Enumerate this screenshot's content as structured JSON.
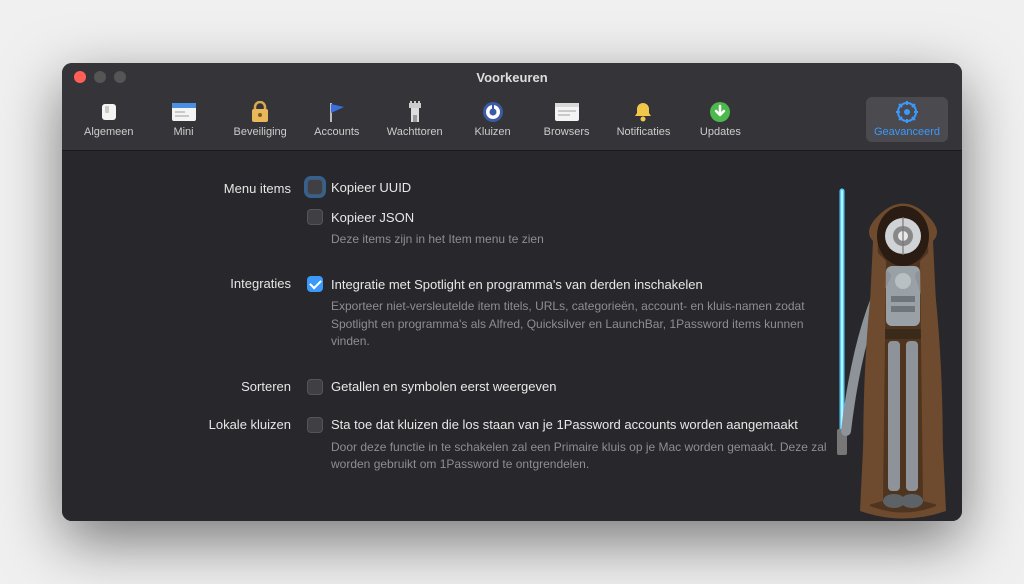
{
  "window": {
    "title": "Voorkeuren"
  },
  "toolbar": {
    "tabs": [
      {
        "label": "Algemeen"
      },
      {
        "label": "Mini"
      },
      {
        "label": "Beveiliging"
      },
      {
        "label": "Accounts"
      },
      {
        "label": "Wachttoren"
      },
      {
        "label": "Kluizen"
      },
      {
        "label": "Browsers"
      },
      {
        "label": "Notificaties"
      },
      {
        "label": "Updates"
      }
    ],
    "advanced": {
      "label": "Geavanceerd"
    }
  },
  "sections": {
    "menu_items": {
      "label": "Menu items",
      "copy_uuid": "Kopieer UUID",
      "copy_json": "Kopieer JSON",
      "help": "Deze items zijn in het Item menu te zien"
    },
    "integrations": {
      "label": "Integraties",
      "enable": "Integratie met Spotlight en programma's van derden inschakelen",
      "help": "Exporteer niet-versleutelde item titels, URLs, categorieën, account- en kluis-namen zodat Spotlight en programma's als Alfred, Quicksilver en LaunchBar, 1Password items kunnen vinden."
    },
    "sorting": {
      "label": "Sorteren",
      "numbers_first": "Getallen en symbolen eerst weergeven"
    },
    "local_vaults": {
      "label": "Lokale kluizen",
      "allow": "Sta toe dat kluizen die los staan van je 1Password accounts worden aangemaakt",
      "help": "Door deze functie in te schakelen zal een Primaire kluis op je Mac worden gemaakt. Deze zal worden gebruikt om 1Password te ontgrendelen."
    }
  }
}
